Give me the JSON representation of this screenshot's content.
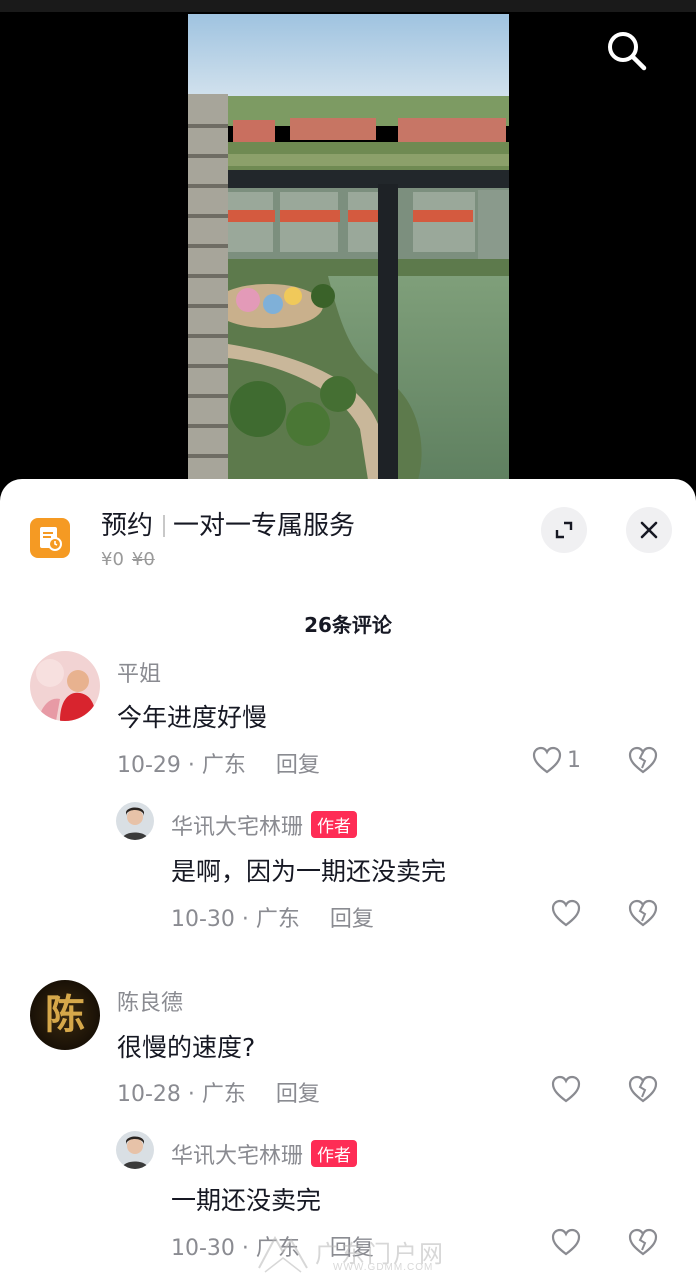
{
  "video": {
    "search_icon": "search-icon"
  },
  "promo": {
    "icon": "calendar-clock-icon",
    "title_main": "预约",
    "title_sub": "一对一专属服务",
    "price": "¥0",
    "original_price": "¥0"
  },
  "comments_header": {
    "count_label": "26条评论"
  },
  "comments": [
    {
      "user": "平姐",
      "text": "今年进度好慢",
      "date": "10-29 · 广东",
      "reply_label": "回复",
      "likes": "1",
      "replies": [
        {
          "user": "华讯大宅林珊",
          "badge": "作者",
          "text": "是啊，因为一期还没卖完",
          "date": "10-30 · 广东",
          "reply_label": "回复"
        }
      ]
    },
    {
      "user": "陈良德",
      "avatar_char": "陈",
      "text": "很慢的速度?",
      "date": "10-28 · 广东",
      "reply_label": "回复",
      "replies": [
        {
          "user": "华讯大宅林珊",
          "badge": "作者",
          "text": "一期还没卖完",
          "date": "10-30 · 广东",
          "reply_label": "回复"
        }
      ]
    }
  ],
  "watermark": {
    "text": "广东门户网",
    "url": "WWW.GDMM.COM"
  },
  "colors": {
    "accent": "#fe2c55",
    "promo_icon": "#f59a23",
    "secondary_text": "#8a8b91"
  }
}
